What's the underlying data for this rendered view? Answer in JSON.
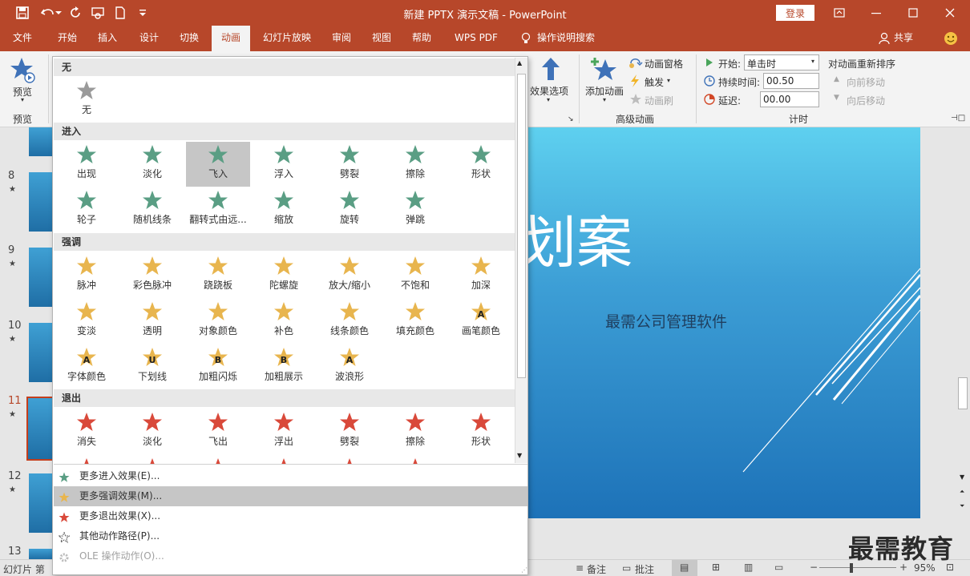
{
  "app": {
    "title": "新建 PPTX 演示文稿  -  PowerPoint",
    "login": "登录"
  },
  "menu": [
    "文件",
    "开始",
    "插入",
    "设计",
    "切换",
    "动画",
    "幻灯片放映",
    "审阅",
    "视图",
    "帮助",
    "WPS PDF",
    "操作说明搜索"
  ],
  "share": "共享",
  "ribbon": {
    "preview": "预览",
    "preview_group": "预览",
    "effect_options": "效果选项",
    "add_animation": "添加动画",
    "anim_pane": "动画窗格",
    "trigger": "触发",
    "anim_brush": "动画刷",
    "advanced_group": "高级动画",
    "start_label": "开始:",
    "start_value": "单击时",
    "duration_label": "持续时间:",
    "duration_value": "00.50",
    "delay_label": "延迟:",
    "delay_value": "00.00",
    "timing_group": "计时",
    "reorder": "对动画重新排序",
    "move_earlier": "向前移动",
    "move_later": "向后移动"
  },
  "colors": {
    "enter": "#5a9e84",
    "emph": "#e8b54e",
    "exit": "#d9493a",
    "none": "#9a9a9a"
  },
  "gallery": {
    "none_head": "无",
    "none_items": [
      "无"
    ],
    "enter_head": "进入",
    "enter_items": [
      "出现",
      "淡化",
      "飞入",
      "浮入",
      "劈裂",
      "擦除",
      "形状",
      "轮子",
      "随机线条",
      "翻转式由远...",
      "缩放",
      "旋转",
      "弹跳"
    ],
    "emph_head": "强调",
    "emph_items": [
      "脉冲",
      "彩色脉冲",
      "跷跷板",
      "陀螺旋",
      "放大/缩小",
      "不饱和",
      "加深",
      "变淡",
      "透明",
      "对象颜色",
      "补色",
      "线条颜色",
      "填充颜色",
      "画笔颜色",
      "字体颜色",
      "下划线",
      "加粗闪烁",
      "加粗展示",
      "波浪形"
    ],
    "emph_letters": {
      "13": "A",
      "14": "A",
      "15": "U",
      "16": "B",
      "17": "B",
      "18": "A"
    },
    "exit_head": "退出",
    "exit_items": [
      "消失",
      "淡化",
      "飞出",
      "浮出",
      "劈裂",
      "擦除",
      "形状"
    ]
  },
  "more": [
    "更多进入效果(E)...",
    "更多强调效果(M)...",
    "更多退出效果(X)...",
    "其他动作路径(P)...",
    "OLE 操作动作(O)..."
  ],
  "slides": [
    "8",
    "9",
    "10",
    "11",
    "12",
    "13"
  ],
  "slide": {
    "title_part": "划案",
    "subtitle": "最需公司管理软件"
  },
  "status": {
    "slide_info": "幻灯片 第",
    "notes": "备注",
    "comments": "批注",
    "zoom": "95%"
  },
  "watermark": "最需教育"
}
